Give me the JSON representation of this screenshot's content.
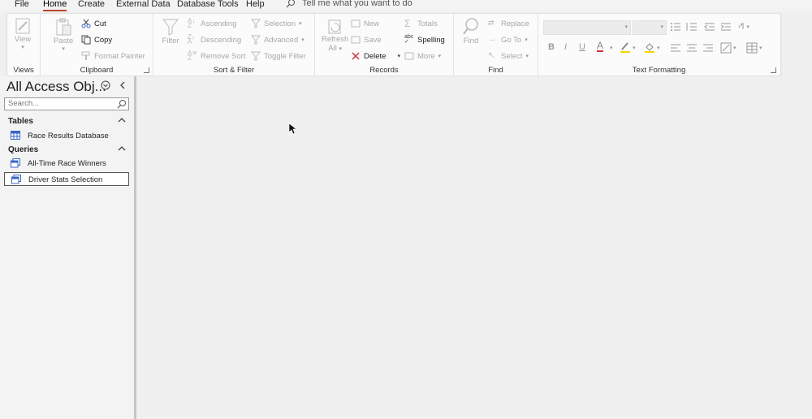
{
  "menu": {
    "tabs": [
      "File",
      "Home",
      "Create",
      "External Data",
      "Database Tools",
      "Help"
    ],
    "tell_me": "Tell me what you want to do"
  },
  "ribbon": {
    "views": {
      "view_label": "View",
      "group_label": "Views"
    },
    "clipboard": {
      "paste_label": "Paste",
      "cut_label": "Cut",
      "copy_label": "Copy",
      "format_painter_label": "Format Painter",
      "group_label": "Clipboard"
    },
    "sort_filter": {
      "filter_label": "Filter",
      "ascending_label": "Ascending",
      "descending_label": "Descending",
      "remove_sort_label": "Remove Sort",
      "selection_label": "Selection",
      "advanced_label": "Advanced",
      "toggle_filter_label": "Toggle Filter",
      "group_label": "Sort & Filter"
    },
    "records": {
      "refresh_label": "Refresh",
      "refresh_all_label": "All",
      "new_label": "New",
      "save_label": "Save",
      "delete_label": "Delete",
      "totals_label": "Totals",
      "spelling_label": "Spelling",
      "more_label": "More",
      "group_label": "Records"
    },
    "find": {
      "find_label": "Find",
      "replace_label": "Replace",
      "goto_label": "Go To",
      "select_label": "Select",
      "group_label": "Find"
    },
    "text_formatting": {
      "bold": "B",
      "italic": "I",
      "underline": "U",
      "font_color_glyph": "A",
      "group_label": "Text Formatting"
    }
  },
  "nav": {
    "title": "All Access Obj...",
    "search_placeholder": "Search...",
    "sections": [
      {
        "label": "Tables",
        "items": [
          {
            "label": "Race Results Database"
          }
        ]
      },
      {
        "label": "Queries",
        "items": [
          {
            "label": "All-Time Race Winners"
          },
          {
            "label": "Driver Stats Selection"
          }
        ]
      }
    ]
  }
}
